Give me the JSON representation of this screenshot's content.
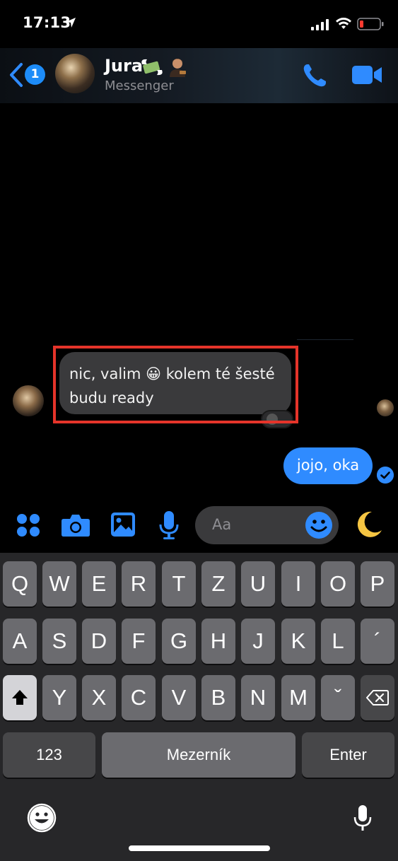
{
  "status_bar": {
    "time": "17:13"
  },
  "header": {
    "unread_count": "1",
    "contact_name": "Jura",
    "contact_subtitle": "Messenger"
  },
  "messages": [
    {
      "direction": "incoming",
      "text_line1": "nic, valim 😀 kolem té šesté",
      "text_line2": "budu ready",
      "highlighted": true
    },
    {
      "direction": "outgoing",
      "text": "jojo, oka",
      "status": "seen"
    }
  ],
  "composer": {
    "placeholder": "Aa"
  },
  "keyboard": {
    "row1": [
      "Q",
      "W",
      "E",
      "R",
      "T",
      "Z",
      "U",
      "I",
      "O",
      "P"
    ],
    "row2": [
      "A",
      "S",
      "D",
      "F",
      "G",
      "H",
      "J",
      "K",
      "L",
      "´"
    ],
    "row3": [
      "Y",
      "X",
      "C",
      "V",
      "B",
      "N",
      "M",
      "ˇ"
    ],
    "numbers_label": "123",
    "space_label": "Mezerník",
    "enter_label": "Enter"
  },
  "colors": {
    "accent": "#2f8bff",
    "highlight": "#e5342a",
    "bubble_in": "#3a3a3c"
  }
}
